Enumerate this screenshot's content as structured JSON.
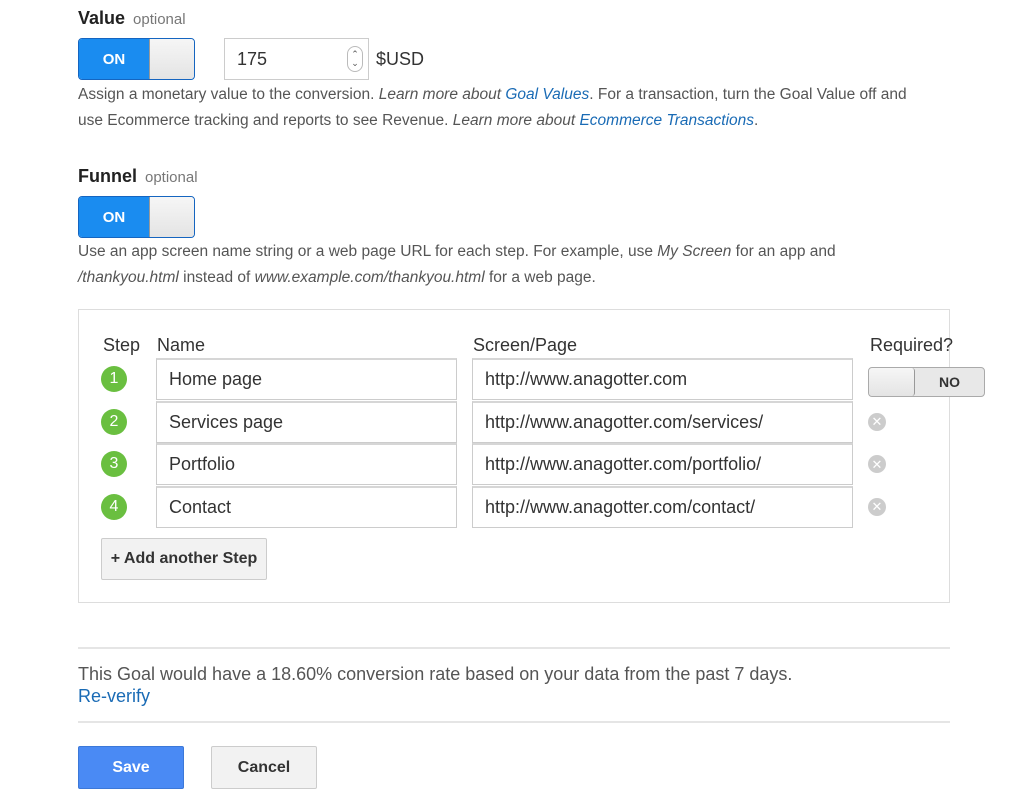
{
  "value_section": {
    "title": "Value",
    "optional": "optional",
    "toggle_label": "ON",
    "toggle_state": "on",
    "amount": "175",
    "currency": "$USD",
    "help": {
      "part1": "Assign a monetary value to the conversion. ",
      "learn1": "Learn more about ",
      "link1": "Goal Values",
      "part2": ". For a transaction, turn the Goal Value off and",
      "part3": "use Ecommerce tracking and reports to see Revenue. ",
      "learn2": "Learn more about ",
      "link2": "Ecommerce Transactions",
      "part4": "."
    }
  },
  "funnel_section": {
    "title": "Funnel",
    "optional": "optional",
    "toggle_label": "ON",
    "toggle_state": "on",
    "help": {
      "part1": "Use an app screen name string or a web page URL for each step. For example, use ",
      "example1": "My Screen",
      "part2": " for an app and",
      "example2": "/thankyou.html",
      "part3": " instead of ",
      "example3": "www.example.com/thankyou.html",
      "part4": " for a web page."
    },
    "columns": {
      "step": "Step",
      "name": "Name",
      "screen": "Screen/Page",
      "required": "Required?"
    },
    "required_toggle_label": "NO",
    "required_state": "off",
    "steps": [
      {
        "number": "1",
        "name": "Home page",
        "screen": "http://www.anagotter.com"
      },
      {
        "number": "2",
        "name": "Services page",
        "screen": "http://www.anagotter.com/services/"
      },
      {
        "number": "3",
        "name": "Portfolio",
        "screen": "http://www.anagotter.com/portfolio/"
      },
      {
        "number": "4",
        "name": "Contact",
        "screen": "http://www.anagotter.com/contact/"
      }
    ],
    "add_step_label": "+ Add another Step"
  },
  "verification": {
    "text": "This Goal would have a 18.60% conversion rate based on your data from the past 7 days.",
    "reverify_label": "Re-verify"
  },
  "actions": {
    "save_label": "Save",
    "cancel_label": "Cancel"
  },
  "colors": {
    "accent_blue": "#1a8cf0",
    "link_blue": "#1a6bb5",
    "step_green": "#6abf40",
    "save_blue": "#4a8af4"
  },
  "icons": {
    "spinner": "number-spinner-icon",
    "remove": "remove-step-icon",
    "remove_glyph": "✕",
    "spin_up": "⌃",
    "spin_down": "⌄"
  }
}
